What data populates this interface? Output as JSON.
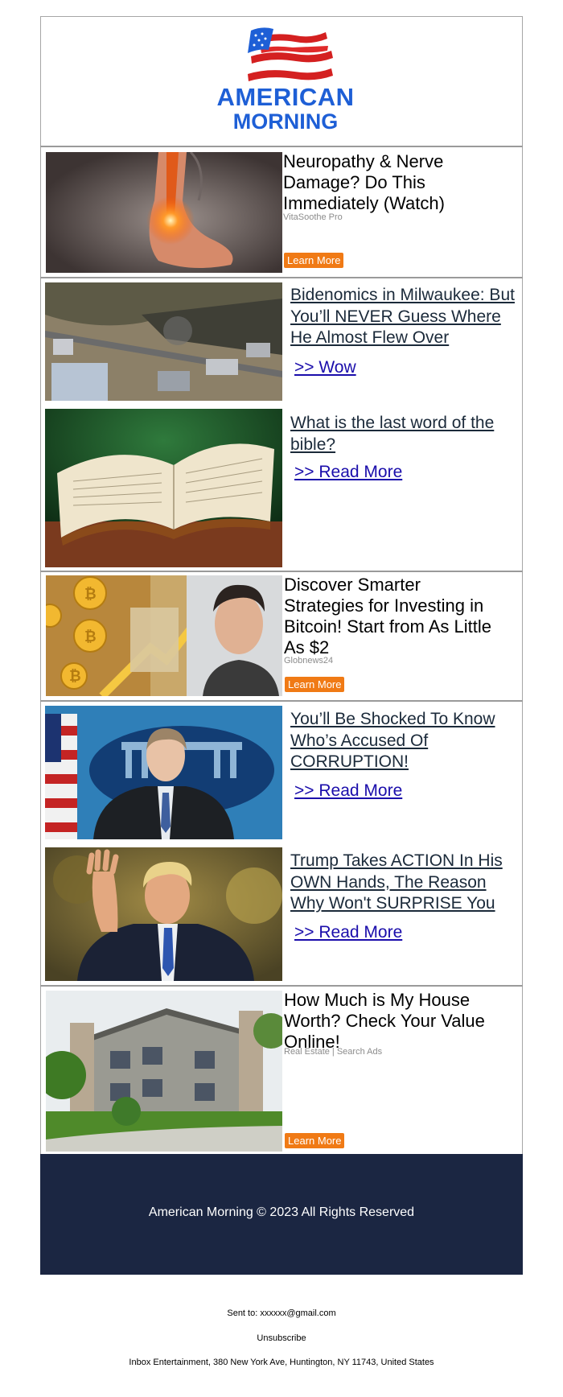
{
  "brand": {
    "line1": "AMERICAN",
    "line2": "MORNING",
    "flag_red": "#d42020",
    "flag_blue": "#1e5fd6"
  },
  "ad1": {
    "title": "Neuropathy & Nerve Damage? Do This Immediately (Watch)",
    "source": "VitaSoothe Pro",
    "button": "Learn More",
    "image_icon": "foot-pain-image"
  },
  "story1": {
    "title": "Bidenomics in Milwaukee: But You’ll NEVER Guess Where He Almost Flew Over",
    "cta": ">> Wow",
    "image_icon": "aerial-town-image"
  },
  "story2": {
    "title": "What is the last word of the bible?",
    "cta": ">> Read More",
    "image_icon": "open-bible-image"
  },
  "ad2": {
    "title": "Discover Smarter Strategies for Investing in Bitcoin! Start from As Little As $2",
    "source": "Globnews24",
    "button": "Learn More",
    "image_icon": "bitcoin-man-image"
  },
  "story3": {
    "title": "You’ll Be Shocked To Know Who’s Accused Of CORRUPTION!",
    "cta": ">> Read More",
    "image_icon": "press-briefing-image"
  },
  "story4": {
    "title": "Trump Takes ACTION In His OWN Hands, The Reason Why Won't SURPRISE You",
    "cta": ">> Read More",
    "image_icon": "waving-man-image"
  },
  "ad3": {
    "title": "How Much is My House Worth? Check Your Value Online!",
    "source": "Real Estate | Search Ads",
    "button": "Learn More",
    "image_icon": "house-image"
  },
  "footer": {
    "copyright": "American Morning © 2023 All Rights Reserved",
    "background": "#1b2642"
  },
  "meta": {
    "sent_to": "Sent to: xxxxxx@gmail.com",
    "unsubscribe": "Unsubscribe",
    "address": "Inbox Entertainment, 380 New York Ave, Huntington, NY 11743, United States"
  },
  "accent": "#f07a15"
}
